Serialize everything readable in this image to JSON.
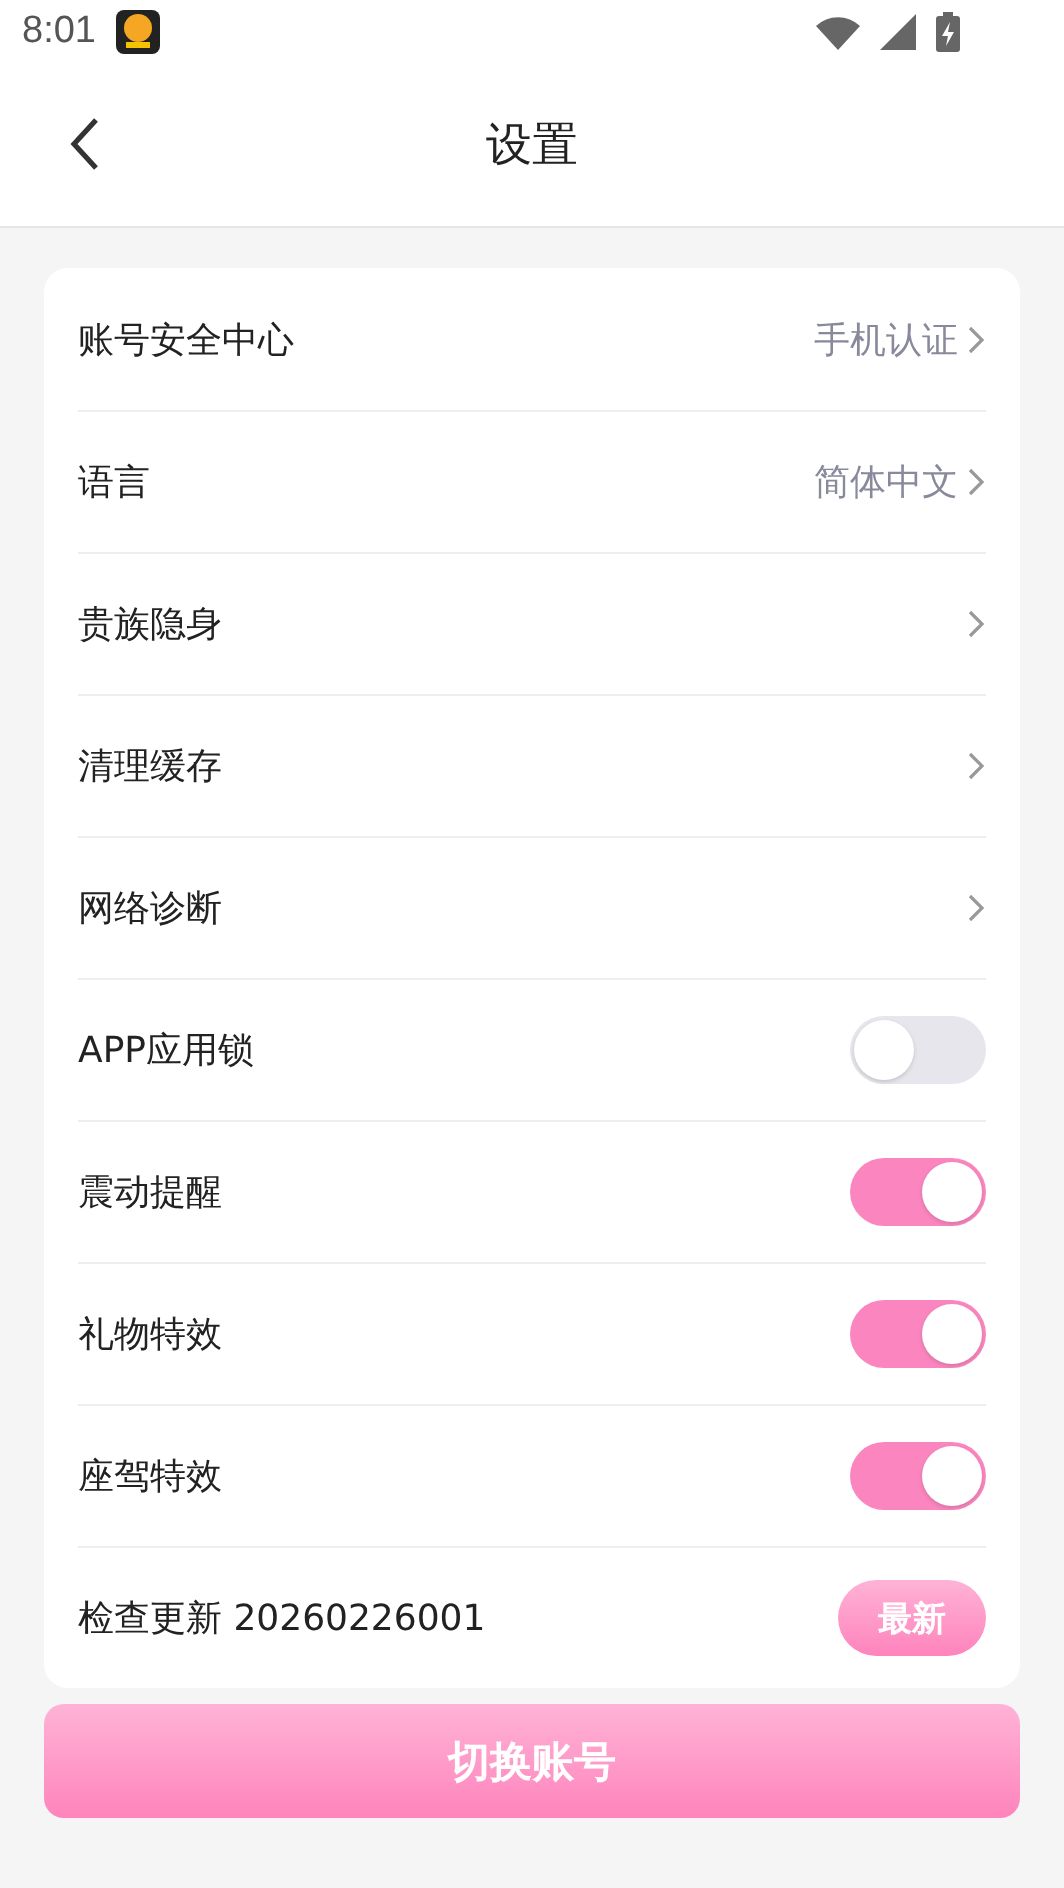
{
  "status_bar": {
    "time": "8:01"
  },
  "header": {
    "title": "设置"
  },
  "settings": [
    {
      "kind": "link",
      "label": "账号安全中心",
      "value": "手机认证"
    },
    {
      "kind": "link",
      "label": "语言",
      "value": "简体中文"
    },
    {
      "kind": "link",
      "label": "贵族隐身"
    },
    {
      "kind": "link",
      "label": "清理缓存"
    },
    {
      "kind": "link",
      "label": "网络诊断"
    },
    {
      "kind": "toggle",
      "label": "APP应用锁",
      "on": false
    },
    {
      "kind": "toggle",
      "label": "震动提醒",
      "on": true
    },
    {
      "kind": "toggle",
      "label": "礼物特效",
      "on": true
    },
    {
      "kind": "toggle",
      "label": "座驾特效",
      "on": true
    },
    {
      "kind": "update",
      "label": "检查更新 20260226001",
      "button": "最新"
    }
  ],
  "switch_account_button": "切换账号"
}
